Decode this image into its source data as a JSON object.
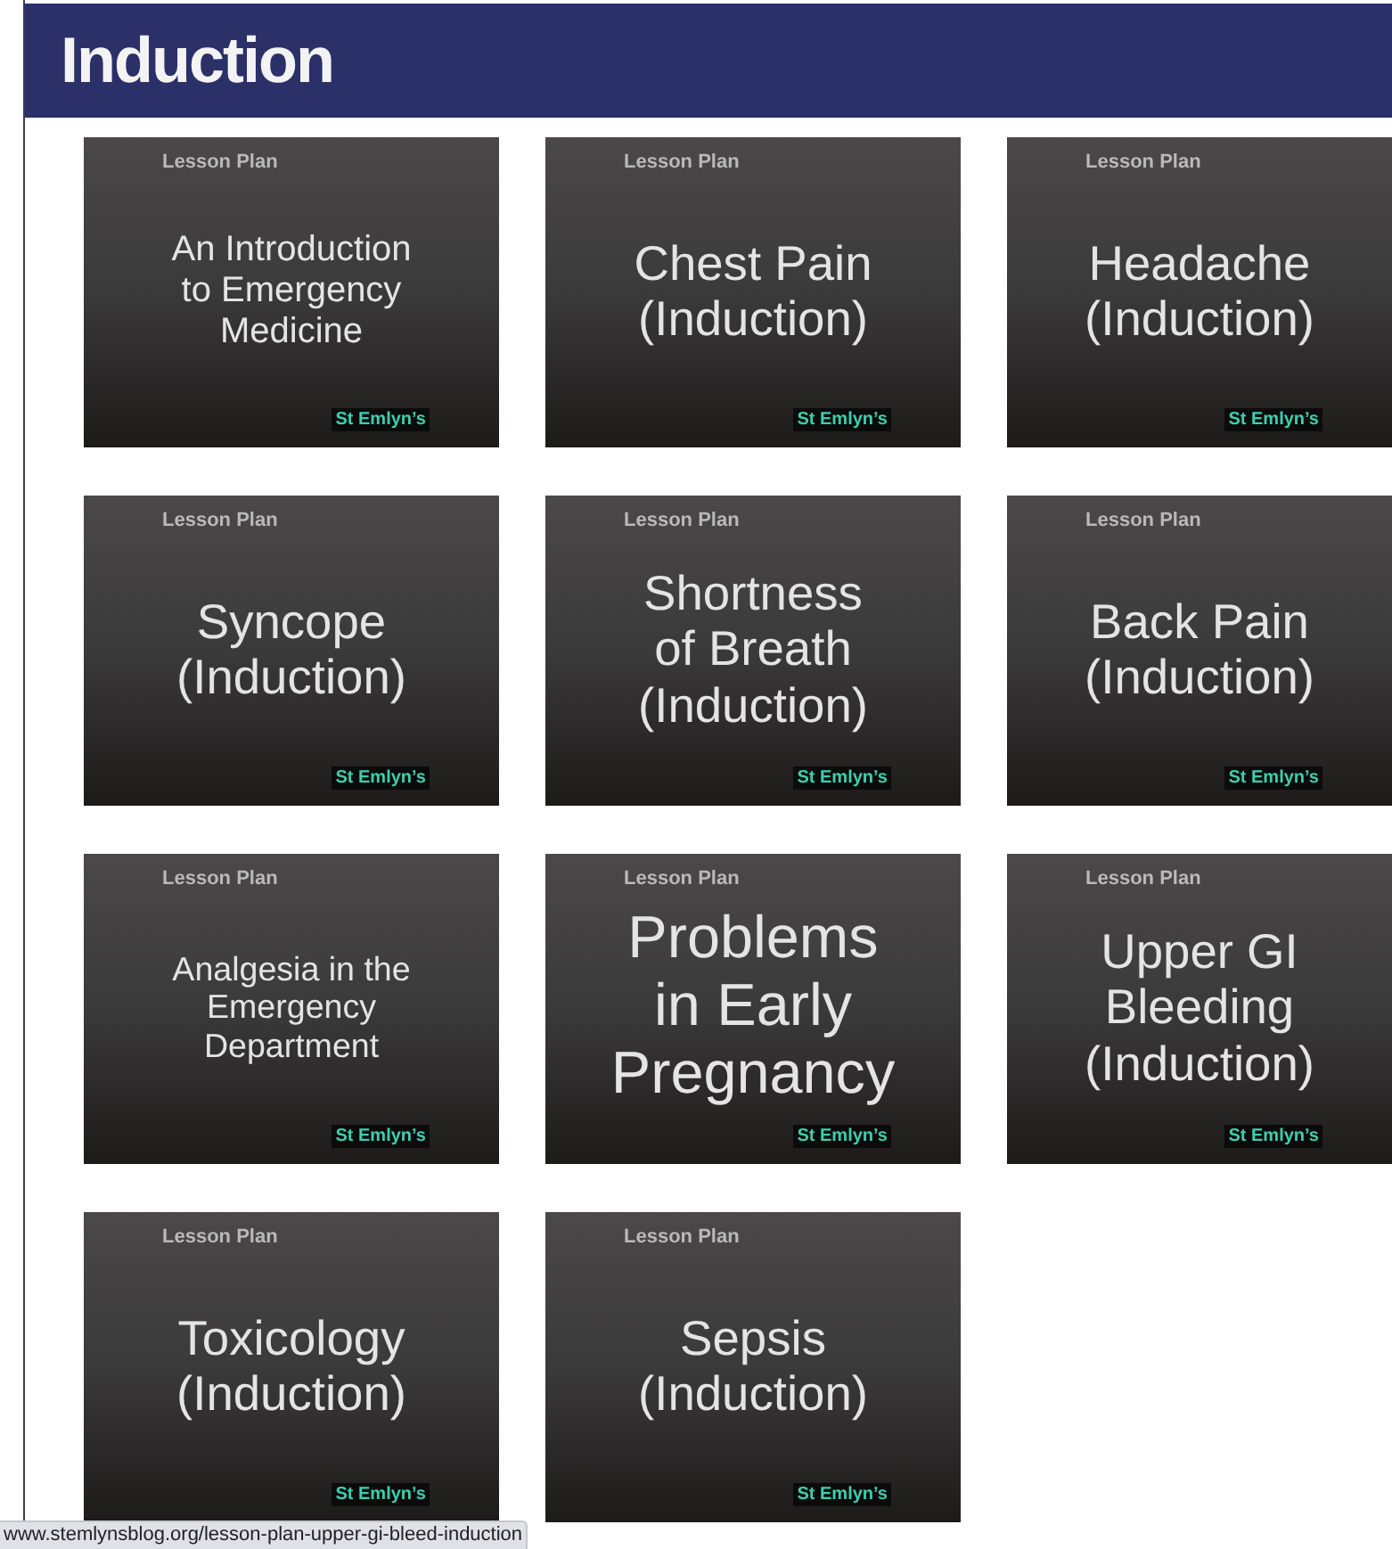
{
  "header": {
    "title": "Induction"
  },
  "lesson_plans": [
    {
      "label": "Lesson Plan",
      "title_lines": [
        "An Introduction",
        "to Emergency",
        "Medicine"
      ],
      "brand": "St Emlyn’s"
    },
    {
      "label": "Lesson Plan",
      "title_lines": [
        "Chest Pain",
        "(Induction)"
      ],
      "brand": "St Emlyn’s"
    },
    {
      "label": "Lesson Plan",
      "title_lines": [
        "Headache",
        "(Induction)"
      ],
      "brand": "St Emlyn’s"
    },
    {
      "label": "Lesson Plan",
      "title_lines": [
        "Syncope",
        "(Induction)"
      ],
      "brand": "St Emlyn’s"
    },
    {
      "label": "Lesson Plan",
      "title_lines": [
        "Shortness",
        "of Breath",
        "(Induction)"
      ],
      "brand": "St Emlyn’s"
    },
    {
      "label": "Lesson Plan",
      "title_lines": [
        "Back Pain",
        "(Induction)"
      ],
      "brand": "St Emlyn’s"
    },
    {
      "label": "Lesson Plan",
      "title_lines": [
        "Analgesia in the",
        "Emergency",
        "Department"
      ],
      "brand": "St Emlyn’s"
    },
    {
      "label": "Lesson Plan",
      "title_lines": [
        "Problems",
        "in Early",
        "Pregnancy"
      ],
      "brand": "St Emlyn’s"
    },
    {
      "label": "Lesson Plan",
      "title_lines": [
        "Upper GI",
        "Bleeding",
        "(Induction)"
      ],
      "brand": "St Emlyn’s"
    },
    {
      "label": "Lesson Plan",
      "title_lines": [
        "Toxicology",
        "(Induction)"
      ],
      "brand": "St Emlyn’s"
    },
    {
      "label": "Lesson Plan",
      "title_lines": [
        "Sepsis",
        "(Induction)"
      ],
      "brand": "St Emlyn’s"
    }
  ],
  "status_bar": {
    "url": "www.stemlynsblog.org/lesson-plan-upper-gi-bleed-induction"
  }
}
